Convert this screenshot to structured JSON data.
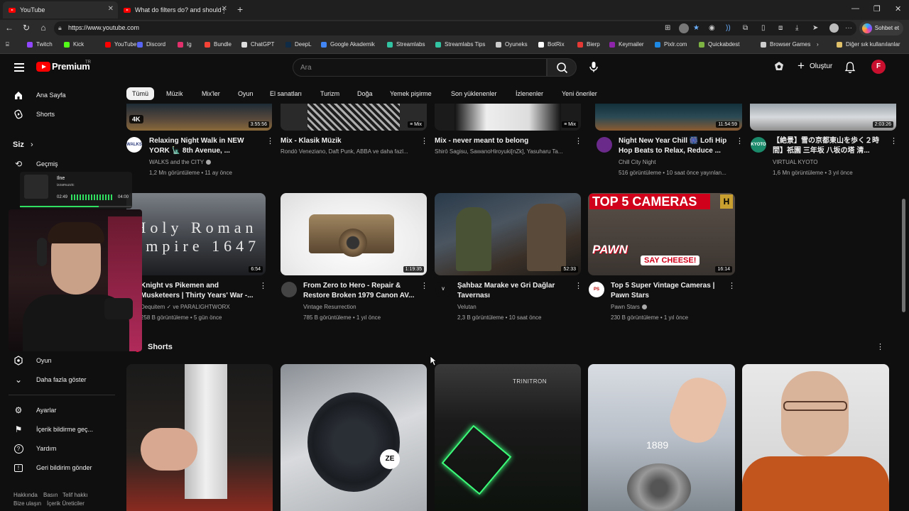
{
  "browser": {
    "tabs": [
      {
        "title": "YouTube",
        "active": true
      },
      {
        "title": "What do filters do? and should yo",
        "active": false
      }
    ],
    "url": "https://www.youtube.com",
    "copilot_label": "Sohbet et",
    "bookmarks": [
      {
        "label": "Twitch",
        "color": "#9146ff"
      },
      {
        "label": "Kick",
        "color": "#53fc18"
      },
      {
        "label": "YouTube",
        "color": "#ff0000"
      },
      {
        "label": "Discord",
        "color": "#5865f2"
      },
      {
        "label": "Ig",
        "color": "#e1306c"
      },
      {
        "label": "Bundle",
        "color": "#f44336"
      },
      {
        "label": "ChatGPT",
        "color": "#dddddd"
      },
      {
        "label": "DeepL",
        "color": "#0f2b46"
      },
      {
        "label": "Google Akademik",
        "color": "#4285f4"
      },
      {
        "label": "Streamlabs",
        "color": "#31c3a2"
      },
      {
        "label": "Streamlabs Tips",
        "color": "#31c3a2"
      },
      {
        "label": "Oyuneks",
        "color": "#cccccc"
      },
      {
        "label": "BotRix",
        "color": "#ffffff"
      },
      {
        "label": "Bierp",
        "color": "#e53935"
      },
      {
        "label": "Keymailer",
        "color": "#8e24aa"
      },
      {
        "label": "Pixlr.com",
        "color": "#1e88e5"
      },
      {
        "label": "Quickabdest",
        "color": "#7cb342"
      },
      {
        "label": "Browser Games",
        "color": "#cccccc"
      }
    ],
    "other_bookmarks": "Diğer sık kullanılanlar"
  },
  "header": {
    "brand": "Premium",
    "country": "TR",
    "search_placeholder": "Ara",
    "create_label": "Oluştur",
    "avatar_letter": "F"
  },
  "sidebar": {
    "top": [
      {
        "label": "Ana Sayfa",
        "icon": "home-icon"
      },
      {
        "label": "Shorts",
        "icon": "shorts-icon"
      }
    ],
    "you_heading": "Siz",
    "you_items": [
      {
        "label": "Geçmiş",
        "icon": "history-icon"
      }
    ],
    "more_items": [
      {
        "label": "Oyun",
        "icon": "gaming-icon"
      },
      {
        "label": "Daha fazla göster",
        "icon": "chevron-down-icon"
      }
    ],
    "settings_items": [
      {
        "label": "Ayarlar",
        "icon": "gear-icon"
      },
      {
        "label": "İçerik bildirme geç...",
        "icon": "flag-icon"
      },
      {
        "label": "Yardım",
        "icon": "help-icon"
      },
      {
        "label": "Geri bildirim gönder",
        "icon": "feedback-icon"
      }
    ],
    "footer": [
      "Hakkında",
      "Basın",
      "Telif hakkı",
      "Bize ulaşın",
      "İçerik Üreticiler"
    ]
  },
  "chips": [
    "Tümü",
    "Müzik",
    "Mix'ler",
    "Oyun",
    "El sanatları",
    "Turizm",
    "Doğa",
    "Yemek pişirme",
    "Son yüklenenler",
    "İzlenenler",
    "Yeni öneriler"
  ],
  "row1": [
    {
      "title": "Relaxing Night Walk in NEW YORK 🗽 8th Avenue, ...",
      "channel": "WALKS and the CITY",
      "verified": true,
      "meta": "1,2 Mn görüntüleme • 11 ay önce",
      "duration": "3:55:56",
      "badge": "4K",
      "avatar_text": "WALKS"
    },
    {
      "title": "Mix - Klasik Müzik",
      "channel": "Rondò Veneziano, Daft Punk, ABBA ve daha fazl...",
      "verified": false,
      "meta": "",
      "duration": "Mix",
      "badge": "",
      "avatar_text": ""
    },
    {
      "title": "Mix - never meant to belong",
      "channel": "Shirō Sagisu, SawanoHiroyuki[nZk], Yasuharu Ta...",
      "verified": false,
      "meta": "",
      "duration": "Mix",
      "badge": "",
      "avatar_text": ""
    },
    {
      "title": "Night New Year Chill 🎆 Lofi Hip Hop Beats to Relax, Reduce ...",
      "channel": "Chill City Night",
      "verified": false,
      "meta": "516 görüntüleme • 10 saat önce yayınlan...",
      "duration": "11:54:59",
      "badge": "",
      "avatar_text": ""
    },
    {
      "title": "【絶景】雪の京都東山を歩く２時間】祇園 三年坂 八坂の塔 清...",
      "channel": "VIRTUAL KYOTO",
      "verified": false,
      "meta": "1,6 Mn görüntüleme • 3 yıl önce",
      "duration": "2:03:26",
      "badge": "",
      "avatar_text": "KYOTO"
    }
  ],
  "row2": [
    {
      "title": "Knight vs Pikemen and Musketeers | Thirty Years' War -...",
      "channel": "Dequitem ✓ ve PARALIGHTWORX",
      "verified": true,
      "meta": "258 B görüntüleme • 5 gün önce",
      "duration": "6:54",
      "thumb_text": "Holy Roman Empire 1647"
    },
    {
      "title": "From Zero to Hero - Repair & Restore Broken 1979 Canon AV...",
      "channel": "Vintage Resurrection",
      "verified": false,
      "meta": "785 B görüntüleme • 1 yıl önce",
      "duration": "1:19:35",
      "thumb_text": ""
    },
    {
      "title": "Şahbaz Marake ve Gri Dağlar Tavernası",
      "channel": "Velutan",
      "verified": false,
      "meta": "2,3 B görüntüleme • 10 saat önce",
      "duration": "52:33",
      "thumb_text": ""
    },
    {
      "title": "Top 5 Super Vintage Cameras | Pawn Stars",
      "channel": "Pawn Stars",
      "verified": true,
      "meta": "230 B görüntüleme • 1 yıl önce",
      "duration": "16:14",
      "thumb_text": "TOP 5 CAMERAS",
      "thumb_sub": "SAY CHEESE!"
    }
  ],
  "shorts": {
    "heading": "Shorts",
    "items": [
      {
        "overlay": ""
      },
      {
        "overlay": "ZE"
      },
      {
        "overlay": "TRINITRON"
      },
      {
        "overlay": "1889"
      },
      {
        "overlay": ""
      }
    ]
  },
  "music_overlay": {
    "title": "Ilne",
    "artist": "izzamuzzic",
    "elapsed": "02:49",
    "total": "04:00",
    "progress": 0.7
  }
}
